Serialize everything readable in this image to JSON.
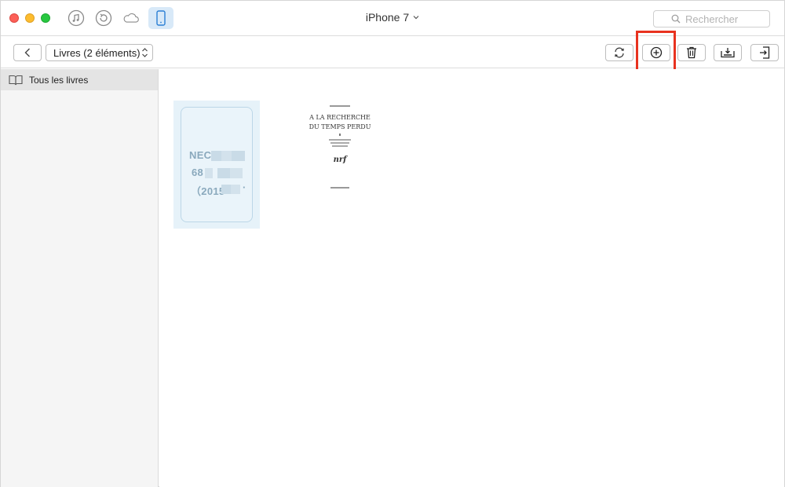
{
  "titlebar": {
    "device_title": "iPhone 7",
    "nav_icons": [
      "music-icon",
      "backup-icon",
      "cloud-icon",
      "phone-icon"
    ]
  },
  "search": {
    "placeholder": "Rechercher"
  },
  "toolbar": {
    "category_select": "Livres (2 éléments)",
    "buttons": [
      "refresh-icon",
      "add-icon",
      "trash-icon",
      "export-icon",
      "import-icon"
    ],
    "highlight_color": "#e8321f"
  },
  "sidebar": {
    "items": [
      {
        "label": "Tous les livres",
        "icon": "book-icon"
      }
    ]
  },
  "books": [
    {
      "cover_lines": [
        "NEC",
        "68",
        "（2015",
        "·"
      ]
    },
    {
      "cover_lines": [
        "A LA RECHERCHE",
        "DU TEMPS PERDU",
        "nrf"
      ]
    }
  ]
}
